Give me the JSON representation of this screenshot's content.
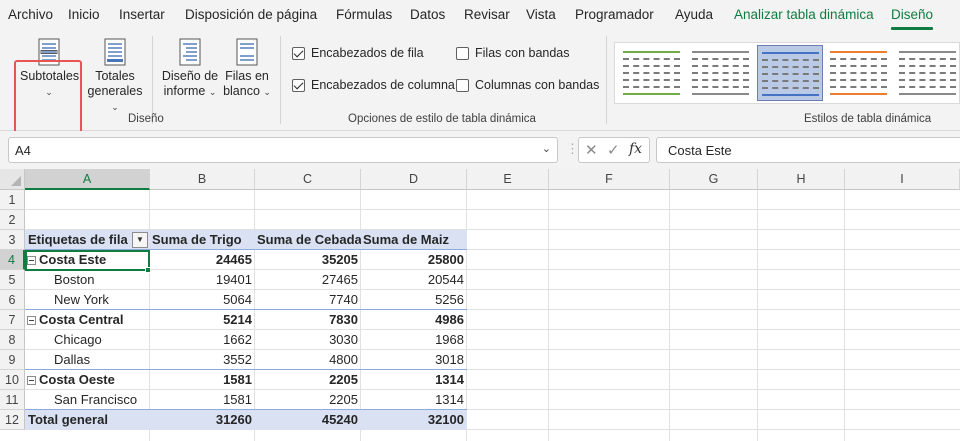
{
  "menu": {
    "tabs": [
      "Archivo",
      "Inicio",
      "Insertar",
      "Disposición de página",
      "Fórmulas",
      "Datos",
      "Revisar",
      "Vista",
      "Programador",
      "Ayuda"
    ],
    "context_tabs": [
      "Analizar tabla dinámica",
      "Diseño"
    ],
    "active_tab": "Diseño",
    "accent_color": "#107c41"
  },
  "ribbon": {
    "diseno_group": {
      "buttons": [
        {
          "line1": "Subtotales",
          "line2": "",
          "icon": "subtotals-icon"
        },
        {
          "line1": "Totales",
          "line2": "generales",
          "icon": "grand-totals-icon"
        },
        {
          "line1": "Diseño de",
          "line2": "informe",
          "icon": "report-layout-icon"
        },
        {
          "line1": "Filas en",
          "line2": "blanco",
          "icon": "blank-rows-icon"
        }
      ],
      "label": "Diseño"
    },
    "options_group": {
      "checkboxes": [
        {
          "label": "Encabezados de fila",
          "checked": true
        },
        {
          "label": "Encabezados de columna",
          "checked": true
        },
        {
          "label": "Filas con bandas",
          "checked": false
        },
        {
          "label": "Columnas con bandas",
          "checked": false
        }
      ],
      "label": "Opciones de estilo de tabla dinámica"
    },
    "styles_group": {
      "label": "Estilos de tabla dinámica",
      "swatch_colors": [
        "#70ad47",
        "#8a8a8a",
        "#4472c4",
        "#ed7d31"
      ]
    },
    "highlight_color": "#e85454"
  },
  "formula_bar": {
    "name_box": "A4",
    "formula": "Costa Este",
    "cancel_symbol": "✕",
    "enter_symbol": "✓",
    "fx_symbol": "fx"
  },
  "sheet": {
    "columns": [
      "A",
      "B",
      "C",
      "D",
      "E",
      "F",
      "G",
      "H",
      "I"
    ],
    "rows": [
      "1",
      "2",
      "3",
      "4",
      "5",
      "6",
      "7",
      "8",
      "9",
      "10",
      "11",
      "12"
    ],
    "selected_cell": "A4",
    "header_fill": "#d9e1f2",
    "pivot": {
      "headers": [
        "Etiquetas de fila",
        "Suma de Trigo",
        "Suma de Cebada",
        "Suma de Maiz"
      ],
      "rows": [
        {
          "label": "Costa Este",
          "level": 0,
          "values": [
            "24465",
            "35205",
            "25800"
          ]
        },
        {
          "label": "Boston",
          "level": 1,
          "values": [
            "19401",
            "27465",
            "20544"
          ]
        },
        {
          "label": "New York",
          "level": 1,
          "values": [
            "5064",
            "7740",
            "5256"
          ]
        },
        {
          "label": "Costa Central",
          "level": 0,
          "values": [
            "5214",
            "7830",
            "4986"
          ]
        },
        {
          "label": "Chicago",
          "level": 1,
          "values": [
            "1662",
            "3030",
            "1968"
          ]
        },
        {
          "label": "Dallas",
          "level": 1,
          "values": [
            "3552",
            "4800",
            "3018"
          ]
        },
        {
          "label": "Costa Oeste",
          "level": 0,
          "values": [
            "1581",
            "2205",
            "1314"
          ]
        },
        {
          "label": "San Francisco",
          "level": 1,
          "values": [
            "1581",
            "2205",
            "1314"
          ]
        }
      ],
      "total": {
        "label": "Total general",
        "values": [
          "31260",
          "45240",
          "32100"
        ]
      }
    }
  }
}
